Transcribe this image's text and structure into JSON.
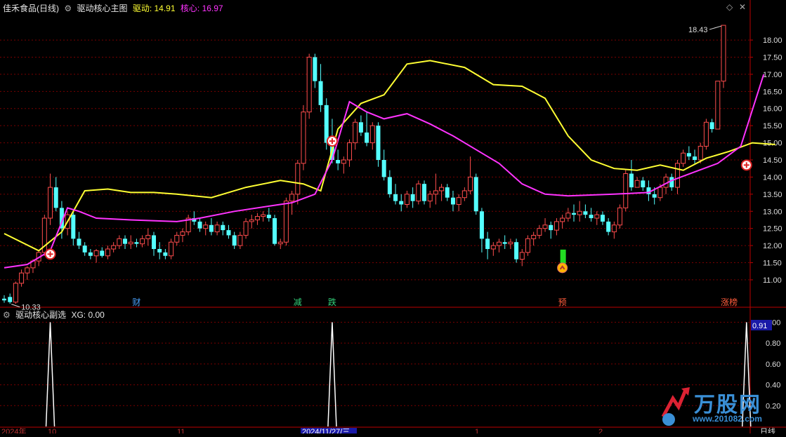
{
  "header": {
    "stock_name": "佳禾食品(日线)",
    "indicator_name": "驱动核心主图",
    "drive_label": "驱动:",
    "drive_value": "14.91",
    "core_label": "核心:",
    "core_value": "16.97"
  },
  "sub_header": {
    "indicator_name": "驱动核心副选",
    "xg_label": "XG:",
    "xg_value": "0.00",
    "cursor_value": "0.91"
  },
  "markers": {
    "high_label": "18.43",
    "low_label": "10.33"
  },
  "events": [
    {
      "text": "财",
      "color": "#4aa3ff",
      "idx": 23
    },
    {
      "text": "减",
      "color": "#33d17a",
      "idx": 51
    },
    {
      "text": "跌",
      "color": "#33d17a",
      "idx": 57
    },
    {
      "text": "预",
      "color": "#ff5b3b",
      "idx": 97
    },
    {
      "text": "涨榜",
      "color": "#ff5b3b",
      "idx": 126
    }
  ],
  "x_axis_labels": [
    "2024年",
    "10",
    "11",
    "2024/11/27/三",
    "1",
    "2",
    "日线"
  ],
  "watermark": {
    "brand": "万股网",
    "url": "www.201082.com"
  },
  "colors": {
    "up": "#ff4d4d",
    "down": "#54ffff",
    "drive_line": "#ffff33",
    "core_line": "#ff33ff",
    "grid": "#7a0000",
    "axis_text": "#dddddd",
    "buy_marker": "#ffffff"
  },
  "chart_data": [
    {
      "type": "candlestick",
      "title": "驱动核心主图",
      "ylim": [
        10.2,
        18.8
      ],
      "yticks": [
        "11.00",
        "11.50",
        "12.00",
        "12.50",
        "13.00",
        "13.50",
        "14.00",
        "14.50",
        "15.00",
        "15.50",
        "16.00",
        "16.50",
        "17.00",
        "17.50",
        "18.00"
      ],
      "candles": [
        [
          10.45,
          10.55,
          10.33,
          10.4
        ],
        [
          10.5,
          10.6,
          10.3,
          10.35
        ],
        [
          10.35,
          10.95,
          10.3,
          10.9
        ],
        [
          10.9,
          11.3,
          10.8,
          11.2
        ],
        [
          11.2,
          11.4,
          11.0,
          11.35
        ],
        [
          11.35,
          11.6,
          11.2,
          11.55
        ],
        [
          11.55,
          11.85,
          11.4,
          11.8
        ],
        [
          11.8,
          12.9,
          11.7,
          12.8
        ],
        [
          12.8,
          14.1,
          12.6,
          13.7
        ],
        [
          13.7,
          14.0,
          13.0,
          13.1
        ],
        [
          13.1,
          13.3,
          12.2,
          12.5
        ],
        [
          12.5,
          13.0,
          12.3,
          12.9
        ],
        [
          12.9,
          13.0,
          12.0,
          12.2
        ],
        [
          12.2,
          12.4,
          11.9,
          12.0
        ],
        [
          12.0,
          12.1,
          11.7,
          11.8
        ],
        [
          11.8,
          11.9,
          11.6,
          11.7
        ],
        [
          11.7,
          11.9,
          11.5,
          11.85
        ],
        [
          11.85,
          11.95,
          11.65,
          11.7
        ],
        [
          11.7,
          12.0,
          11.6,
          11.9
        ],
        [
          11.9,
          12.1,
          11.8,
          12.0
        ],
        [
          12.0,
          12.3,
          11.9,
          12.2
        ],
        [
          12.2,
          12.3,
          11.9,
          12.05
        ],
        [
          12.05,
          12.3,
          11.9,
          12.1
        ],
        [
          12.1,
          12.2,
          11.95,
          12.05
        ],
        [
          12.05,
          12.3,
          11.95,
          12.2
        ],
        [
          12.2,
          12.5,
          12.0,
          12.3
        ],
        [
          12.3,
          12.4,
          11.7,
          11.9
        ],
        [
          11.9,
          12.1,
          11.6,
          11.8
        ],
        [
          11.8,
          11.9,
          11.6,
          11.7
        ],
        [
          11.7,
          12.2,
          11.6,
          12.1
        ],
        [
          12.1,
          12.4,
          12.0,
          12.3
        ],
        [
          12.3,
          12.5,
          12.1,
          12.4
        ],
        [
          12.4,
          12.9,
          12.3,
          12.8
        ],
        [
          12.8,
          13.0,
          12.6,
          12.7
        ],
        [
          12.7,
          12.8,
          12.4,
          12.5
        ],
        [
          12.5,
          12.7,
          12.3,
          12.6
        ],
        [
          12.6,
          12.8,
          12.3,
          12.4
        ],
        [
          12.4,
          12.7,
          12.3,
          12.6
        ],
        [
          12.6,
          12.7,
          12.3,
          12.45
        ],
        [
          12.45,
          12.6,
          12.2,
          12.3
        ],
        [
          12.3,
          12.4,
          11.9,
          12.0
        ],
        [
          12.0,
          12.4,
          11.9,
          12.3
        ],
        [
          12.3,
          12.8,
          12.2,
          12.7
        ],
        [
          12.7,
          12.9,
          12.5,
          12.75
        ],
        [
          12.75,
          12.95,
          12.6,
          12.85
        ],
        [
          12.85,
          13.0,
          12.7,
          12.9
        ],
        [
          12.9,
          13.1,
          12.7,
          12.8
        ],
        [
          12.8,
          12.9,
          12.0,
          12.05
        ],
        [
          12.05,
          12.2,
          11.9,
          12.1
        ],
        [
          12.1,
          13.4,
          12.0,
          13.3
        ],
        [
          13.3,
          13.6,
          12.9,
          13.5
        ],
        [
          13.5,
          14.5,
          13.2,
          14.4
        ],
        [
          14.4,
          16.1,
          14.2,
          15.9
        ],
        [
          15.9,
          17.6,
          15.7,
          17.5
        ],
        [
          17.5,
          17.6,
          16.6,
          16.8
        ],
        [
          16.8,
          17.3,
          15.9,
          16.1
        ],
        [
          16.1,
          16.3,
          14.8,
          15.0
        ],
        [
          15.0,
          15.7,
          14.4,
          14.5
        ],
        [
          14.5,
          14.8,
          14.2,
          14.4
        ],
        [
          14.4,
          14.6,
          14.1,
          14.5
        ],
        [
          14.5,
          15.1,
          14.3,
          15.0
        ],
        [
          15.0,
          15.7,
          14.8,
          15.6
        ],
        [
          15.6,
          15.8,
          15.2,
          15.3
        ],
        [
          15.3,
          15.9,
          14.9,
          15.0
        ],
        [
          15.0,
          15.6,
          14.8,
          15.5
        ],
        [
          15.5,
          15.6,
          14.3,
          14.5
        ],
        [
          14.5,
          14.8,
          13.9,
          14.0
        ],
        [
          14.0,
          14.2,
          13.4,
          13.5
        ],
        [
          13.5,
          13.8,
          13.2,
          13.3
        ],
        [
          13.3,
          13.5,
          13.0,
          13.2
        ],
        [
          13.2,
          13.6,
          13.1,
          13.5
        ],
        [
          13.5,
          13.7,
          13.1,
          13.3
        ],
        [
          13.3,
          13.9,
          13.2,
          13.8
        ],
        [
          13.8,
          13.9,
          13.2,
          13.3
        ],
        [
          13.3,
          13.6,
          13.1,
          13.5
        ],
        [
          13.5,
          14.1,
          13.2,
          13.6
        ],
        [
          13.6,
          13.8,
          13.3,
          13.7
        ],
        [
          13.7,
          13.8,
          13.3,
          13.4
        ],
        [
          13.4,
          13.6,
          13.0,
          13.2
        ],
        [
          13.2,
          13.5,
          13.0,
          13.4
        ],
        [
          13.4,
          13.7,
          13.3,
          13.6
        ],
        [
          13.6,
          14.6,
          13.5,
          14.0
        ],
        [
          14.0,
          14.1,
          12.9,
          13.0
        ],
        [
          13.0,
          13.1,
          11.8,
          12.2
        ],
        [
          12.2,
          12.4,
          11.6,
          11.9
        ],
        [
          11.9,
          12.1,
          11.7,
          12.0
        ],
        [
          12.0,
          12.2,
          11.8,
          12.1
        ],
        [
          12.1,
          12.3,
          11.9,
          12.05
        ],
        [
          12.05,
          12.2,
          11.9,
          12.1
        ],
        [
          12.1,
          12.2,
          11.5,
          11.6
        ],
        [
          11.6,
          11.9,
          11.4,
          11.8
        ],
        [
          11.8,
          12.3,
          11.7,
          12.2
        ],
        [
          12.2,
          12.4,
          12.0,
          12.3
        ],
        [
          12.3,
          12.6,
          12.2,
          12.5
        ],
        [
          12.5,
          12.8,
          12.4,
          12.6
        ],
        [
          12.6,
          12.7,
          12.2,
          12.45
        ],
        [
          12.45,
          12.8,
          12.3,
          12.7
        ],
        [
          12.7,
          12.9,
          12.5,
          12.8
        ],
        [
          12.8,
          13.1,
          12.7,
          12.95
        ],
        [
          12.95,
          13.2,
          12.7,
          12.9
        ],
        [
          12.9,
          13.3,
          12.7,
          13.0
        ],
        [
          13.0,
          13.2,
          12.8,
          12.9
        ],
        [
          12.9,
          13.1,
          12.7,
          12.8
        ],
        [
          12.8,
          13.0,
          12.6,
          12.9
        ],
        [
          12.9,
          13.0,
          12.6,
          12.7
        ],
        [
          12.7,
          12.8,
          12.3,
          12.4
        ],
        [
          12.4,
          12.7,
          12.2,
          12.6
        ],
        [
          12.6,
          13.2,
          12.5,
          13.1
        ],
        [
          13.1,
          14.2,
          13.0,
          14.1
        ],
        [
          14.1,
          14.5,
          13.6,
          13.7
        ],
        [
          13.7,
          14.0,
          13.8,
          13.9
        ],
        [
          13.9,
          14.0,
          13.6,
          13.7
        ],
        [
          13.7,
          13.9,
          13.3,
          13.5
        ],
        [
          13.5,
          13.7,
          13.2,
          13.4
        ],
        [
          13.4,
          13.8,
          13.3,
          13.7
        ],
        [
          13.7,
          14.1,
          13.5,
          14.0
        ],
        [
          14.0,
          14.1,
          13.6,
          13.7
        ],
        [
          13.7,
          14.5,
          13.5,
          14.4
        ],
        [
          14.4,
          14.8,
          14.3,
          14.7
        ],
        [
          14.7,
          14.9,
          14.5,
          14.6
        ],
        [
          14.6,
          14.8,
          14.4,
          14.5
        ],
        [
          14.5,
          15.0,
          14.4,
          14.9
        ],
        [
          14.9,
          15.7,
          14.8,
          15.6
        ],
        [
          15.6,
          15.7,
          15.3,
          15.4
        ],
        [
          15.4,
          16.8,
          15.4,
          16.8
        ],
        [
          16.8,
          18.43,
          16.6,
          18.43
        ]
      ],
      "drive_line": [
        [
          0,
          12.35
        ],
        [
          6,
          11.85
        ],
        [
          10,
          12.4
        ],
        [
          14,
          13.6
        ],
        [
          18,
          13.65
        ],
        [
          22,
          13.55
        ],
        [
          26,
          13.55
        ],
        [
          30,
          13.5
        ],
        [
          36,
          13.4
        ],
        [
          42,
          13.7
        ],
        [
          48,
          13.9
        ],
        [
          52,
          13.8
        ],
        [
          55,
          13.6
        ],
        [
          58,
          15.4
        ],
        [
          62,
          16.15
        ],
        [
          66,
          16.4
        ],
        [
          70,
          17.3
        ],
        [
          74,
          17.4
        ],
        [
          80,
          17.2
        ],
        [
          85,
          16.7
        ],
        [
          90,
          16.65
        ],
        [
          94,
          16.3
        ],
        [
          98,
          15.2
        ],
        [
          102,
          14.5
        ],
        [
          106,
          14.25
        ],
        [
          110,
          14.2
        ],
        [
          114,
          14.35
        ],
        [
          118,
          14.2
        ],
        [
          122,
          14.55
        ],
        [
          126,
          14.75
        ],
        [
          130,
          15.0
        ],
        [
          134,
          14.95
        ]
      ],
      "core_line": [
        [
          0,
          11.35
        ],
        [
          4,
          11.45
        ],
        [
          8,
          11.85
        ],
        [
          11,
          13.1
        ],
        [
          13,
          13.0
        ],
        [
          16,
          12.8
        ],
        [
          22,
          12.75
        ],
        [
          30,
          12.7
        ],
        [
          34,
          12.8
        ],
        [
          40,
          13.0
        ],
        [
          46,
          13.15
        ],
        [
          50,
          13.25
        ],
        [
          54,
          13.5
        ],
        [
          57,
          14.5
        ],
        [
          60,
          16.2
        ],
        [
          63,
          15.9
        ],
        [
          66,
          15.7
        ],
        [
          70,
          15.85
        ],
        [
          74,
          15.55
        ],
        [
          78,
          15.2
        ],
        [
          82,
          14.8
        ],
        [
          86,
          14.4
        ],
        [
          90,
          13.8
        ],
        [
          94,
          13.5
        ],
        [
          98,
          13.45
        ],
        [
          106,
          13.5
        ],
        [
          112,
          13.55
        ],
        [
          116,
          13.9
        ],
        [
          120,
          14.15
        ],
        [
          124,
          14.4
        ],
        [
          128,
          14.9
        ],
        [
          132,
          17.0
        ]
      ],
      "buy_markers": [
        {
          "idx": 8,
          "price": 11.75,
          "kind": "plus"
        },
        {
          "idx": 57,
          "price": 15.05,
          "kind": "plus"
        },
        {
          "idx": 129,
          "price": 14.35,
          "kind": "plus"
        },
        {
          "idx": 97,
          "price": 11.35,
          "kind": "up"
        }
      ]
    },
    {
      "type": "line",
      "title": "驱动核心副选",
      "series": [
        {
          "name": "XG",
          "spikes": [
            8,
            57,
            129
          ]
        }
      ],
      "ylim": [
        0,
        1.05
      ],
      "yticks": [
        "0.20",
        "0.40",
        "0.60",
        "0.80",
        "1.00"
      ]
    }
  ]
}
